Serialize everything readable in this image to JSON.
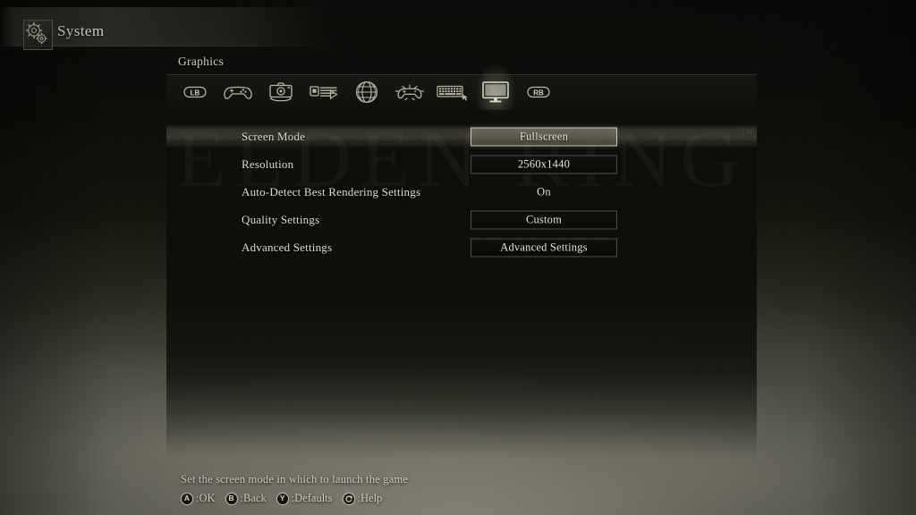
{
  "header": {
    "title": "System",
    "icon": "gears-icon"
  },
  "category": {
    "label": "Graphics"
  },
  "tabs": [
    {
      "id": "lb-bumper",
      "icon": "lb-button-icon",
      "label": "LB",
      "selected": false
    },
    {
      "id": "gamepad",
      "icon": "gamepad-icon",
      "label": "Controller",
      "selected": false
    },
    {
      "id": "camera",
      "icon": "camera-icon",
      "label": "Camera",
      "selected": false
    },
    {
      "id": "subtitles",
      "icon": "subtitles-icon",
      "label": "Subtitles",
      "selected": false
    },
    {
      "id": "network",
      "icon": "globe-icon",
      "label": "Network",
      "selected": false
    },
    {
      "id": "key-bindings",
      "icon": "gamepad-bindings-icon",
      "label": "Controller Keys",
      "selected": false
    },
    {
      "id": "keyboard",
      "icon": "keyboard-icon",
      "label": "Keyboard",
      "selected": false
    },
    {
      "id": "graphics",
      "icon": "monitor-icon",
      "label": "Graphics",
      "selected": true
    },
    {
      "id": "rb-bumper",
      "icon": "rb-button-icon",
      "label": "RB",
      "selected": false
    }
  ],
  "settings": {
    "rows": [
      {
        "label": "Screen Mode",
        "value": "Fullscreen",
        "style": "box",
        "selected": true
      },
      {
        "label": "Resolution",
        "value": "2560x1440",
        "style": "box",
        "selected": false
      },
      {
        "label": "Auto-Detect Best Rendering Settings",
        "value": "On",
        "style": "plain",
        "selected": false
      },
      {
        "label": "Quality Settings",
        "value": "Custom",
        "style": "box",
        "selected": false
      },
      {
        "label": "Advanced Settings",
        "value": "Advanced Settings",
        "style": "box",
        "selected": false
      }
    ]
  },
  "watermark": {
    "text": "ELDEN RING",
    "trademark": "TM"
  },
  "footer": {
    "description": "Set the screen mode in which to launch the game",
    "prompts": [
      {
        "glyph": "A",
        "icon": "a-button-icon",
        "label": ":OK"
      },
      {
        "glyph": "B",
        "icon": "b-button-icon",
        "label": ":Back"
      },
      {
        "glyph": "Y",
        "icon": "y-button-icon",
        "label": ":Defaults"
      },
      {
        "glyph": "",
        "icon": "help-button-icon",
        "label": ":Help"
      }
    ]
  },
  "colors": {
    "accent": "#d6d4be",
    "text": "#e4e3d6",
    "panel_bg": "#0d0d0a",
    "fog": "#5d5c52"
  }
}
